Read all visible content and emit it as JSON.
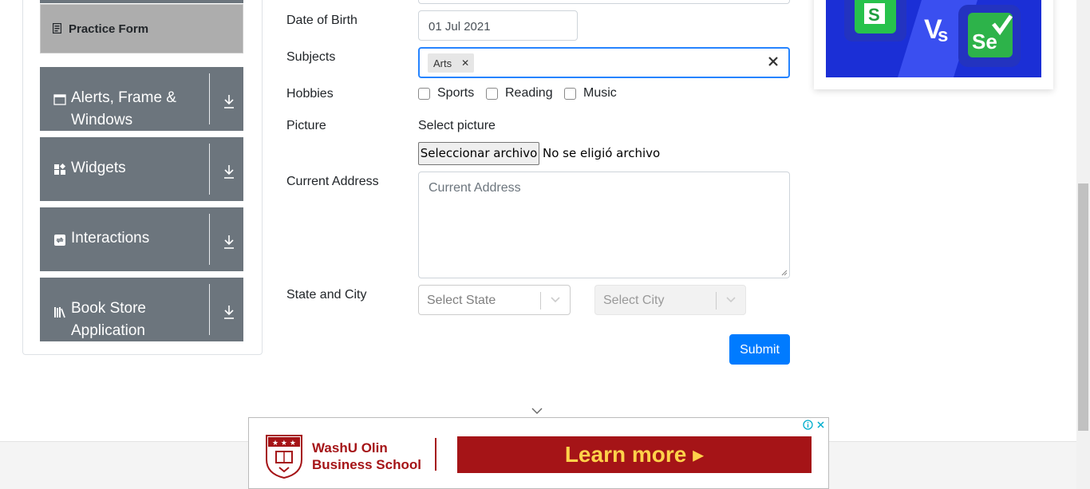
{
  "sidebar": {
    "practice_form": "Practice Form",
    "groups": [
      {
        "label": "Alerts, Frame & Windows",
        "icon": "window-icon"
      },
      {
        "label": "Widgets",
        "icon": "widgets-icon"
      },
      {
        "label": "Interactions",
        "icon": "interactions-icon"
      },
      {
        "label": "Book Store Application",
        "icon": "books-icon"
      }
    ]
  },
  "form": {
    "dob_label": "Date of Birth",
    "dob_value": "01 Jul 2021",
    "subjects_label": "Subjects",
    "subjects": [
      "Arts"
    ],
    "hobbies_label": "Hobbies",
    "hobbies": [
      "Sports",
      "Reading",
      "Music"
    ],
    "picture_label": "Picture",
    "picture_text": "Select picture",
    "file_button": "Seleccionar archivo",
    "file_status": "No se eligió archivo",
    "address_label": "Current Address",
    "address_placeholder": "Current Address",
    "state_city_label": "State and City",
    "state_placeholder": "Select State",
    "city_placeholder": "Select City",
    "submit": "Submit"
  },
  "ad": {
    "org_line1": "WashU Olin",
    "org_line2": "Business School",
    "cta": "Learn more ▸"
  },
  "colors": {
    "sidebar_group": "#6c757d",
    "submit": "#007bff",
    "focus_border": "#2684ff",
    "ad_red": "#a51417",
    "ad_cta_text": "#ffd24a"
  }
}
